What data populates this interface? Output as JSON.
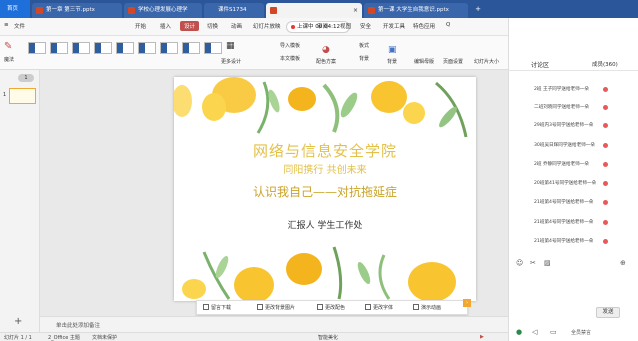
{
  "window": {
    "home_tab": "首页",
    "tabs": [
      {
        "label": "第一章  第三节.pptx",
        "state": "inactive"
      },
      {
        "label": "学校心理发展心理学",
        "state": "inactive"
      },
      {
        "label": "课件S1734",
        "state": "inactive"
      },
      {
        "label": "第一课  大学生自我意识.pptx",
        "state": "inactive"
      },
      {
        "label": "",
        "state": "active"
      }
    ],
    "add_tab": "+"
  },
  "menubar": {
    "file_menu": "文件",
    "items": [
      "开始",
      "插入",
      "设计",
      "切换",
      "动画",
      "幻灯片放映",
      "审阅",
      "视图",
      "安全",
      "开发工具",
      "特色应用"
    ],
    "active_item": "设计",
    "timer_label": "上课中 00:04:12",
    "search_hint": "Q"
  },
  "ribbon": {
    "magic_label": "魔法",
    "more_designs": "更多设计",
    "import_template": "导入模板",
    "this_template": "本文模板",
    "color_scheme": "配色方案",
    "format": "板式",
    "bg": "背景",
    "background": "背景",
    "edit_master": "编辑母版",
    "page_setup": "页面设置",
    "slide_size": "幻灯片大小"
  },
  "leftpane": {
    "slide_number": "1",
    "count_badge": "1",
    "add_button": "+"
  },
  "slide": {
    "title": "网络与信息安全学院",
    "subtitle": "同阳携行  共创未来",
    "topic": "认识我自己——对抗拖延症",
    "reporter": "汇报人  学生工作处",
    "accent_color": "#e2c14a",
    "topic_color": "#c9a227"
  },
  "floatbar": {
    "items": [
      "留言下载",
      "更改背景图片",
      "更改配色",
      "更改字体",
      "演示动画"
    ]
  },
  "notes": {
    "placeholder": "单击此处添加备注"
  },
  "status": {
    "slide_info": "幻灯片 1 / 1",
    "theme": "2_Office 主题",
    "doc_info": "文档未保护",
    "smart_beauty": "智能美化"
  },
  "panel": {
    "tab_discussion": "讨论区",
    "tab_member": "成员(360)",
    "messages": [
      "2班 王子同学送给老师一朵",
      "二班刘晓同学送给老师一朵",
      "29班内3号同学送给老师一朵",
      "30班吴日辉同学送给老师一朵",
      "2班 乔静同学送给老师一朵",
      "20班第41号同学送给老师一朵",
      "21班第4号同学送给老师一朵",
      "21班第4号同学送给老师一朵",
      "21班第4号同学送给老师一朵"
    ],
    "send_label": "发送",
    "bottom_label": "全员禁言"
  }
}
